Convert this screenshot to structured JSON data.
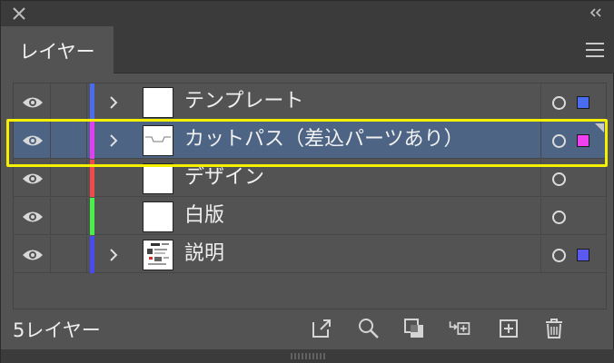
{
  "panel": {
    "tab_label": "レイヤー",
    "layer_count": "5レイヤー"
  },
  "layers": [
    {
      "name": "テンプレート",
      "color": "#4a6cf0",
      "expandable": true,
      "selected": false,
      "has_selection_box": true
    },
    {
      "name": "カットパス（差込パーツあり）",
      "color": "#e040f0",
      "expandable": true,
      "selected": true,
      "has_selection_box": true
    },
    {
      "name": "デザイン",
      "color": "#f04a4a",
      "expandable": false,
      "selected": false,
      "has_selection_box": false
    },
    {
      "name": "白版",
      "color": "#4af04a",
      "expandable": false,
      "selected": false,
      "has_selection_box": false
    },
    {
      "name": "説明",
      "color": "#4a4af0",
      "expandable": true,
      "selected": false,
      "has_selection_box": true
    }
  ],
  "icons": {
    "close": "close-icon",
    "collapse": "double-chevron-icon",
    "menu": "hamburger-menu-icon",
    "visibility": "eye-icon",
    "expand": "chevron-right-icon",
    "target": "target-circle-icon",
    "export": "export-icon",
    "search": "search-icon",
    "clipping_mask": "clipping-mask-icon",
    "new_sublayer": "new-sublayer-icon",
    "new_layer": "new-layer-icon",
    "delete": "trash-icon"
  },
  "colors": {
    "selected_row": "#4d6485",
    "highlight_outline": "#f4f000"
  }
}
